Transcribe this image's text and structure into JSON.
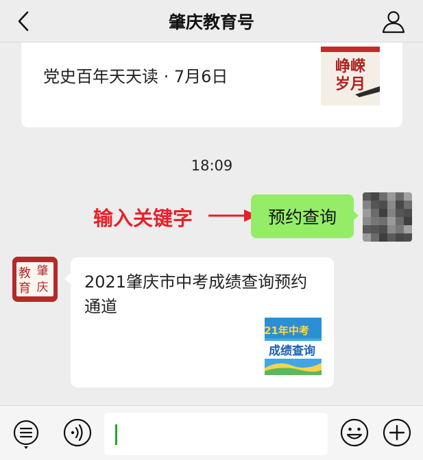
{
  "header": {
    "title": "肇庆教育号"
  },
  "article_top": {
    "title": "党史百年天天读 · 7月6日",
    "thumb_text": "峥嵘岁月"
  },
  "timestamp": "18:09",
  "annotation": "输入关键字",
  "sent_message": "预约查询",
  "reply": {
    "title": "2021肇庆市中考成绩查询预约通道",
    "thumb_line1": "21年中考",
    "thumb_line2": "成绩查询"
  },
  "bot_logo": "教肇育庆",
  "colors": {
    "bubble_green": "#95ec69",
    "annotation_red": "#e8202a",
    "logo_red": "#b5292a",
    "caret_green": "#1aad19"
  },
  "icons": [
    "back-icon",
    "profile-icon",
    "menu-list-icon",
    "voice-icon",
    "emoji-icon",
    "plus-icon"
  ]
}
